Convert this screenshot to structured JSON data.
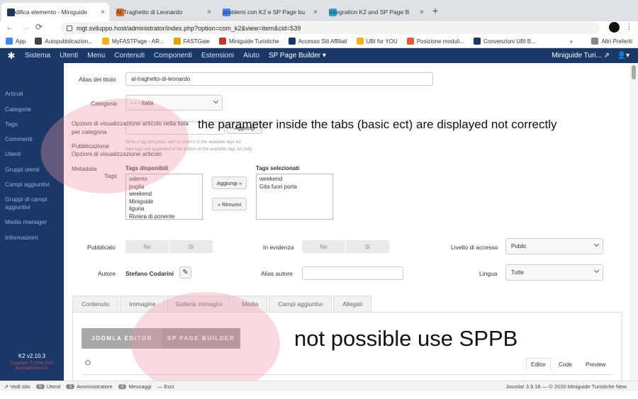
{
  "browser": {
    "tabs": [
      {
        "label": "Modifica elemento - Miniguide",
        "icon_color": "#1a3867",
        "active": true
      },
      {
        "label": "Al Traghetto di Leonardo",
        "icon_color": "#e06a1a",
        "active": false
      },
      {
        "label": "problemi con K2 e SP Page bu",
        "icon_color": "#4285f4",
        "active": false
      },
      {
        "label": "Integration K2 and SP Page B",
        "icon_color": "#2aa7c8",
        "active": false
      }
    ],
    "new_tab": "+",
    "url": "mgt.sviluppo.host/administrator/index.php?option=com_k2&view=item&cid=539",
    "bookmarks": [
      {
        "label": "App",
        "color": "#4285f4"
      },
      {
        "label": "Autopubblicazion...",
        "color": "#444"
      },
      {
        "label": "MyFASTPage - AR...",
        "color": "#f2b21b"
      },
      {
        "label": "FASTGate",
        "color": "#e6a100"
      },
      {
        "label": "Miniguide Turistiche",
        "color": "#c0392b"
      },
      {
        "label": "Accesso Siti Affiliati",
        "color": "#1a3867"
      },
      {
        "label": "UBI for YOU",
        "color": "#f2b21b"
      },
      {
        "label": "Posizione moduli...",
        "color": "#e05c2b"
      },
      {
        "label": "Convenzioni UBI B...",
        "color": "#1a3867"
      }
    ],
    "bookmarks_more": "»",
    "other_bookmarks": "Altri Preferiti"
  },
  "joomla_menu": [
    "Sistema",
    "Utenti",
    "Menu",
    "Contenuti",
    "Componenti",
    "Estensioni",
    "Aiuto"
  ],
  "sp_page_builder": "SP Page Builder ▾",
  "site_name": "Miniguide Turi... ⇗",
  "user_menu": "▾",
  "sidebar": {
    "items": [
      "Articoli",
      "Categorie",
      "Tags",
      "Commenti",
      "Utenti",
      "Gruppi utenti",
      "Campi aggiuntivi",
      "Gruppi di campi aggiuntivi",
      "Media manager",
      "Informazioni"
    ],
    "version": "K2 v2.10.3",
    "copyright": "Copyright © 2006-2020 JoomlaWorks Ltd."
  },
  "form": {
    "alias_label": "Alias del titolo",
    "alias_value": "al-traghetto-di-leonardo",
    "category_label": "Categoria",
    "category_value": "- - - Italia",
    "overlap_items": [
      "Opzioni di visualizzazione articolo nella lista per categoria",
      "Pubblicazione",
      "Opzioni di visualizzazione articolo",
      "Metadata"
    ],
    "tag_hint_1": "Write a tag and press 'add' to insert it to the available tags list.",
    "tag_hint_2": "New tags are appended at the bottom of the available tags list (left).",
    "tag_add_button": "Aggiungi",
    "tags_label": "Tags",
    "tags_available_label": "Tags disponibili",
    "tags_available": [
      "salento",
      "puglia",
      "weekend",
      "Miniguide",
      "liguria",
      "Riviera di ponente"
    ],
    "add_button": "Aggiungi »",
    "remove_button": "« Rimuovi",
    "tags_selected_label": "Tags selezionati",
    "tags_selected": [
      "weekend",
      "Gita fuori porta"
    ],
    "published_label": "Pubblicato",
    "featured_label": "In evidenza",
    "no": "No",
    "yes": "Sì",
    "access_label": "Livello di accesso",
    "access_value": "Public",
    "author_label": "Autore",
    "author_value": "Stefano Codarini",
    "author_alias_label": "Alias autore",
    "language_label": "Lingua",
    "language_value": "Tutte"
  },
  "content_tabs": [
    "Contenuto",
    "Immagine",
    "Galleria immagini",
    "Media",
    "Campi aggiuntivi",
    "Allegati"
  ],
  "editor": {
    "joomla_editor": "JOOMLA EDITOR",
    "sp_page_builder": "SP PAGE BUILDER",
    "tabs": [
      "Editor",
      "Code",
      "Preview"
    ]
  },
  "annotations": {
    "note_tabs": "the parameter inside the tabs (basic ect) are displayed not correctly",
    "note_sppb": "not possible use SPPB"
  },
  "status": {
    "view_site": "Vedi sito",
    "users_count": "0",
    "users": "Utenti",
    "admin_count": "1",
    "admin": "Amministratore",
    "msg_count": "0",
    "messages": "Messaggi",
    "logout": "Esci",
    "footer": "Joomla! 3.9.18 — © 2020 Miniguide Turistiche New"
  }
}
